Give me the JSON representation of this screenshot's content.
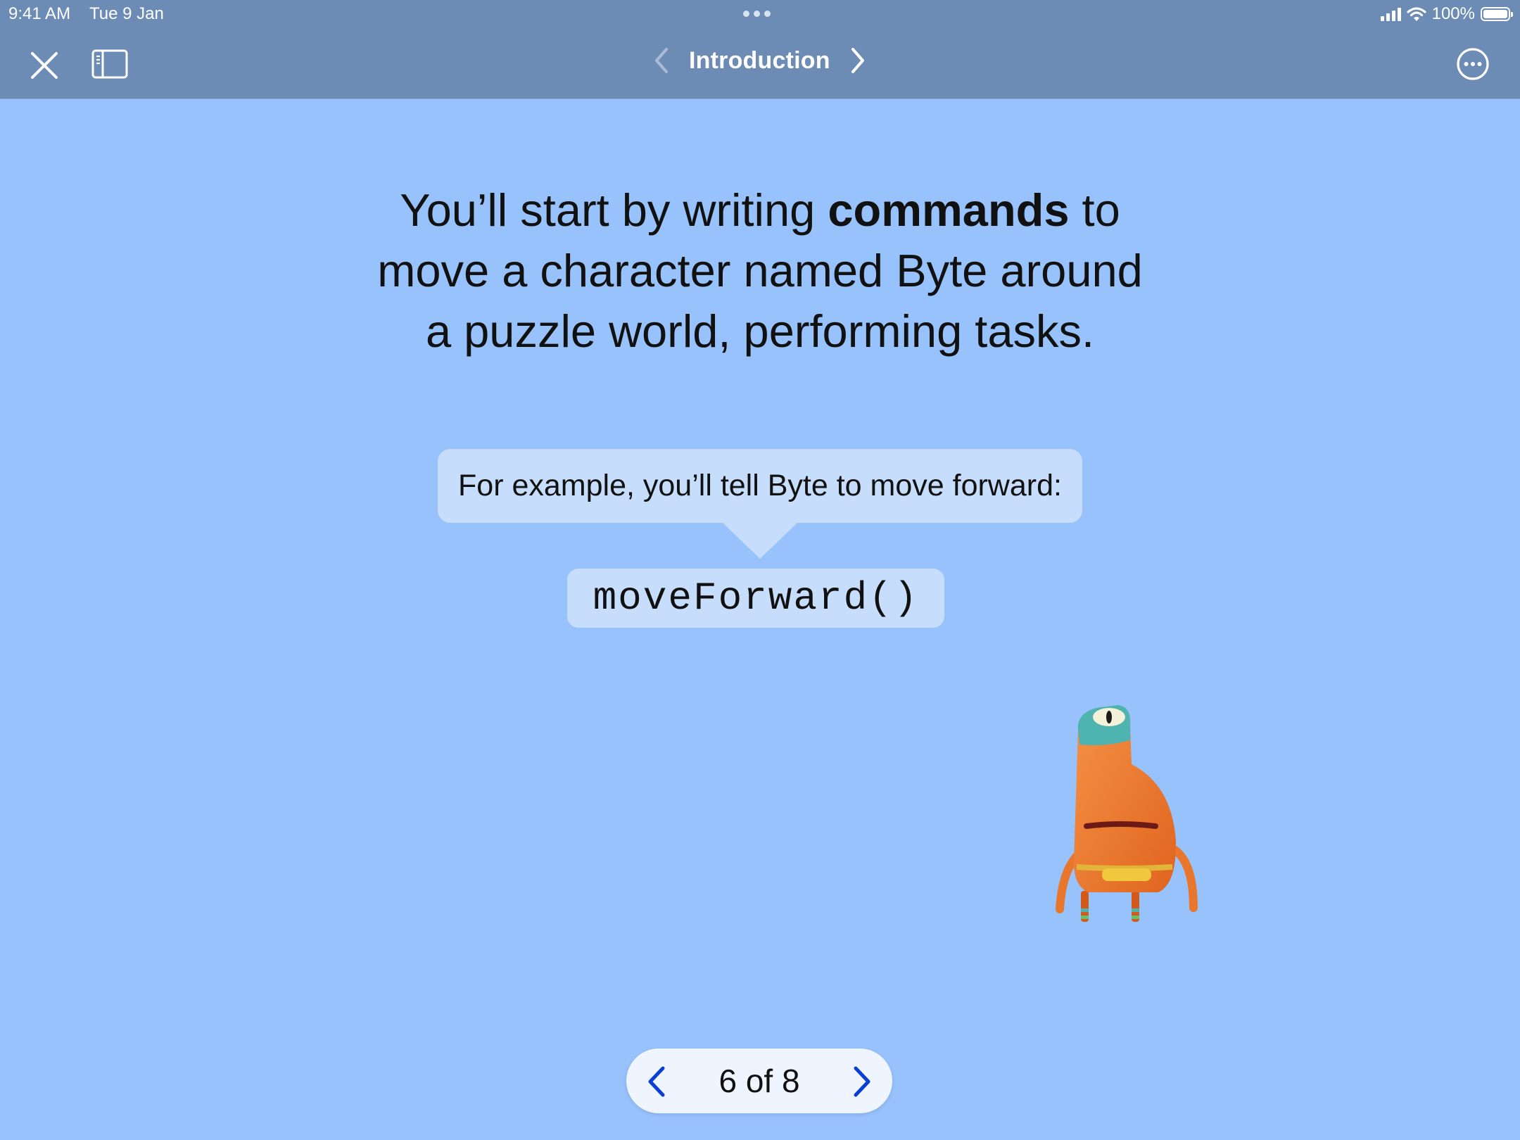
{
  "status_bar": {
    "time": "9:41 AM",
    "date": "Tue 9 Jan",
    "battery_text": "100%",
    "battery_level": 1.0
  },
  "nav": {
    "title": "Introduction",
    "icons": [
      "close-icon",
      "sidebar-icon",
      "chevron-left-icon",
      "chevron-right-icon",
      "more-icon"
    ]
  },
  "content": {
    "headline": {
      "line1_before": "You’ll start by writing ",
      "line1_bold": "commands",
      "line1_after": " to",
      "line2": "move a character named Byte around",
      "line3": "a puzzle world, performing tasks."
    },
    "bubble_text": "For example, you’ll tell Byte to move forward:",
    "code": "moveForward()"
  },
  "pager": {
    "label": "6 of 8",
    "current": 6,
    "total": 8
  },
  "colors": {
    "background": "#98c2fb",
    "nav_bar": "#6c8bb5",
    "bubble": "#c7ddfc",
    "accent": "#0a3fd6",
    "byte_body": "#f07a2a",
    "byte_head": "#4fb3b0"
  }
}
